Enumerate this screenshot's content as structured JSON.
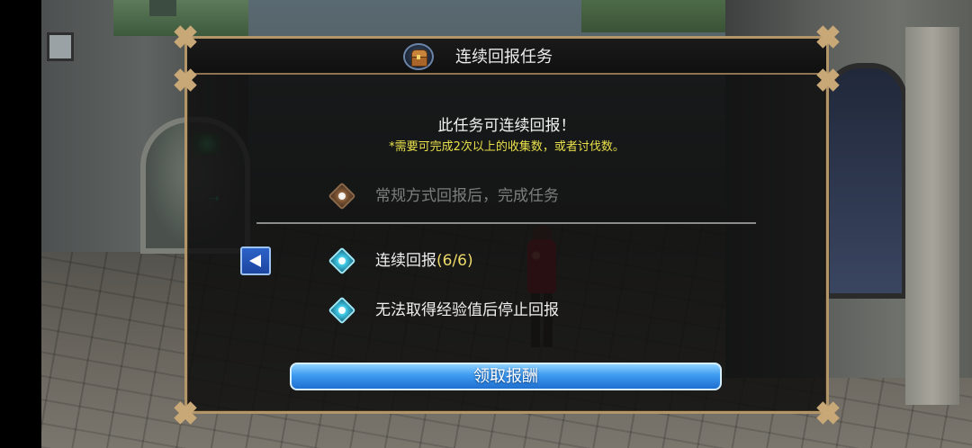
{
  "dialog": {
    "title": "连续回报任务",
    "heading": "此任务可连续回报！",
    "note": "*需要可完成2次以上的收集数，或者讨伐数。",
    "options": {
      "regular": {
        "label": "常规方式回报后，完成任务",
        "state": "disabled"
      },
      "continuous": {
        "label": "连续回报",
        "count": "(6/6)",
        "state": "active"
      },
      "stop": {
        "label": "无法取得经验值后停止回报",
        "state": "active"
      }
    },
    "claim_button": "领取报酬",
    "back_button_icon": "left-arrow-icon",
    "header_icon": "treasure-chest-icon"
  },
  "colors": {
    "frame_gold": "#b3956a",
    "note_yellow": "#e8e04a",
    "count_yellow": "#ecd96a",
    "button_blue": "#3d9bf0",
    "disabled_text": "#7e7e7e"
  }
}
